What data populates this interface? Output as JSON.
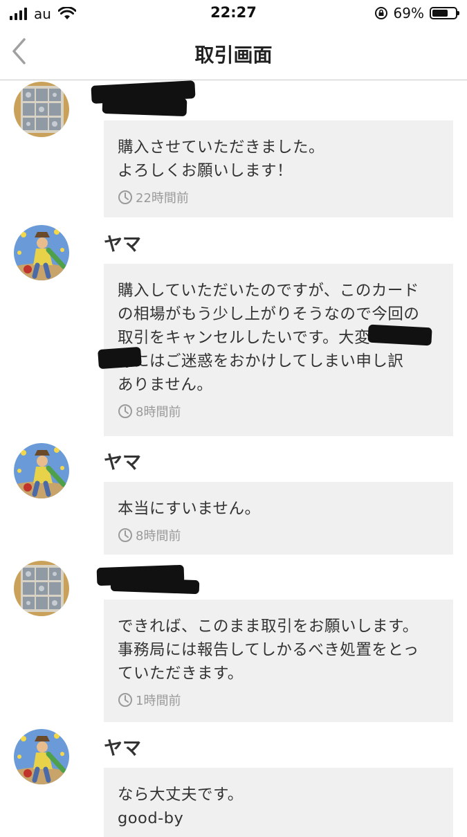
{
  "status": {
    "carrier": "au",
    "time": "22:27",
    "battery": "69%",
    "battery_level": 0.69
  },
  "nav": {
    "title": "取引画面"
  },
  "messages": [
    {
      "sender": "",
      "text": "購入させていただきました。\nよろしくお願いします！",
      "time": "22時間前"
    },
    {
      "sender": "ヤマ",
      "text": "購入していただいたのですが、このカード\nの相場がもう少し上がりそうなので今回の\n取引をキャンセルしたいです。大変\n様にはご迷惑をおかけしてしまい申し訳\nありません。",
      "time": "8時間前"
    },
    {
      "sender": "ヤマ",
      "text": "本当にすいません。",
      "time": "8時間前"
    },
    {
      "sender": "",
      "text": "できれば、このまま取引をお願いします。\n事務局には報告してしかるべき処置をとっ\nていただきます。",
      "time": "1時間前"
    },
    {
      "sender": "ヤマ",
      "text": "なら大丈夫です。\ngood-by",
      "time": ""
    }
  ],
  "icons": {
    "back": "chevron-left-icon",
    "clock": "clock-icon",
    "wifi": "wifi-icon",
    "signal": "signal-icon",
    "rotation_lock": "rotation-lock-icon",
    "battery": "battery-icon"
  }
}
